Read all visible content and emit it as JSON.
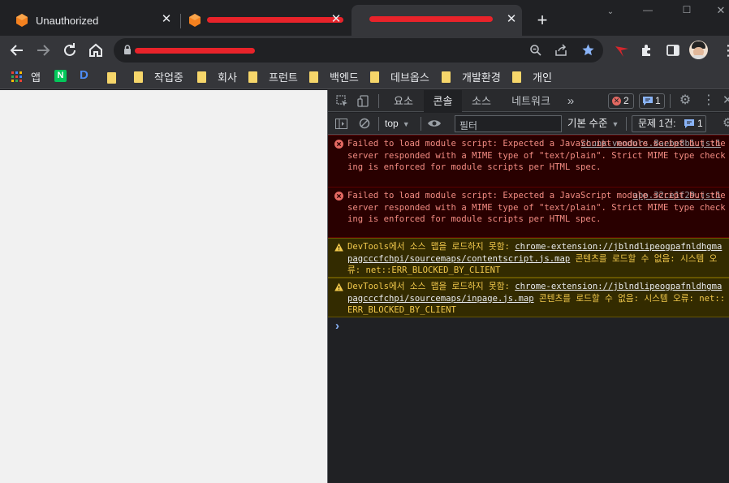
{
  "tabs": [
    {
      "title": "Unauthorized",
      "active": false,
      "icon": "orange-cube-icon"
    },
    {
      "title": "",
      "active": false,
      "icon": "orange-cube-icon",
      "redacted": true
    },
    {
      "title": "",
      "active": true,
      "icon": "",
      "redacted": true
    }
  ],
  "new_tab_label": "+",
  "window_controls": {
    "minimize": "—",
    "maximize": "☐",
    "close": "✕"
  },
  "omnibox": {
    "value": ""
  },
  "bookmarks": {
    "apps": "앱",
    "items": [
      "작업중",
      "회사",
      "프런트",
      "백엔드",
      "데브옵스",
      "개발환경",
      "개인"
    ]
  },
  "devtools": {
    "tabs": [
      "요소",
      "콘솔",
      "소스",
      "네트워크",
      "»"
    ],
    "active_tab": "콘솔",
    "error_count": "2",
    "info_count": "1",
    "context": "top",
    "filter_placeholder": "필터",
    "level": "기본 수준",
    "issues_label": "문제 1건:",
    "issues_count": "1",
    "messages": [
      {
        "level": "error",
        "source": "chunk-vendors.8aebe8b1.js:1",
        "text": "Failed to load module script: Expected a JavaScript module script but the server responded with a MIME type of \"text/plain\". Strict MIME type checking is enforced for module scripts per HTML spec."
      },
      {
        "level": "error",
        "source": "app.32ce1f29.js:1",
        "text": "Failed to load module script: Expected a JavaScript module script but the server responded with a MIME type of \"text/plain\". Strict MIME type checking is enforced for module scripts per HTML spec."
      },
      {
        "level": "warn",
        "prefix": "DevTools에서 소스 맵을 로드하지 못함: ",
        "link": "chrome-extension://jblndlipeogpafnldhgmapagcccfchpi/sourcemaps/contentscript.js.map",
        "suffix": " 콘텐츠를 로드할 수 없음: 시스템 오류: net::ERR_BLOCKED_BY_CLIENT"
      },
      {
        "level": "warn",
        "prefix": "DevTools에서 소스 맵을 로드하지 못함: ",
        "link": "chrome-extension://jblndlipeogpafnldhgmapagcccfchpi/sourcemaps/inpage.js.map",
        "suffix": " 콘텐츠를 로드할 수 없음: 시스템 오류: net::ERR_BLOCKED_BY_CLIENT"
      }
    ],
    "prompt": "›"
  },
  "colors": {
    "error": "#f28b82",
    "warning": "#f2c94c",
    "accent": "#8ab4f8",
    "bookmark_folder": "#f6d66a",
    "redaction": "#e8232a"
  }
}
